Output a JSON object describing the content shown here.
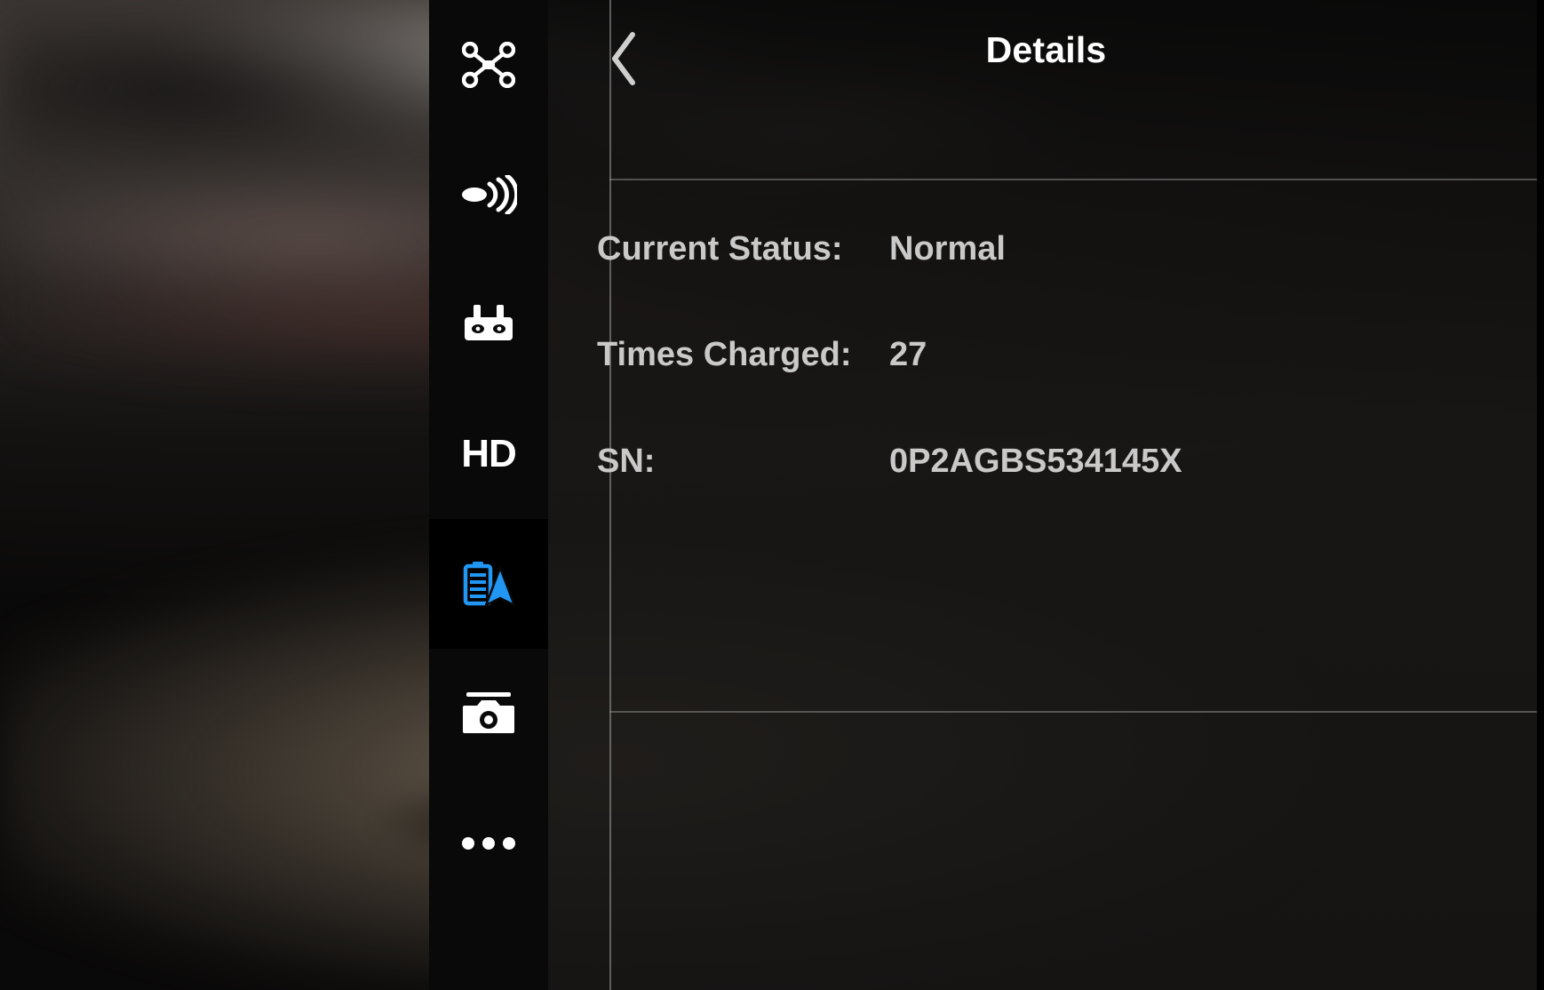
{
  "app": {
    "feed_label": "blurred-camera-feed",
    "accent_color": "#2196f3",
    "panel_bg": "#1a1918",
    "text_color": "#c9c9c9"
  },
  "sidebar": {
    "items": [
      {
        "icon": "drone-icon",
        "label": "Aircraft",
        "selected": false
      },
      {
        "icon": "transmission-icon",
        "label": "Image Transmission",
        "selected": false
      },
      {
        "icon": "remote-controller-icon",
        "label": "Remote Controller",
        "selected": false
      },
      {
        "icon": "hd-icon",
        "label": "HD",
        "selected": false,
        "text": "HD"
      },
      {
        "icon": "battery-aircraft-icon",
        "label": "Battery",
        "selected": true
      },
      {
        "icon": "camera-icon",
        "label": "Camera",
        "selected": false
      },
      {
        "icon": "more-icon",
        "label": "More",
        "selected": false
      }
    ]
  },
  "header": {
    "back_label": "Back",
    "back_icon": "chevron-left-icon",
    "title": "Details"
  },
  "details": {
    "rows": [
      {
        "key": "Current Status:",
        "value": "Normal"
      },
      {
        "key": "Times Charged:",
        "value": "27"
      },
      {
        "key": "SN:",
        "value": "0P2AGBS534145X"
      }
    ]
  }
}
